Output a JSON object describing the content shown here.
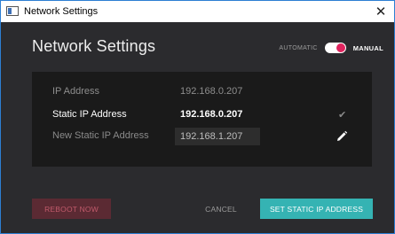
{
  "window": {
    "title": "Network Settings",
    "close_glyph": "✕"
  },
  "header": {
    "title": "Network Settings",
    "mode_automatic_label": "AUTOMATIC",
    "mode_manual_label": "MANUAL",
    "mode_selected": "MANUAL"
  },
  "panel": {
    "rows": [
      {
        "label": "IP Address",
        "value": "192.168.0.207"
      },
      {
        "label": "Static IP Address",
        "value": "192.168.0.207",
        "status_icon": "check-icon"
      },
      {
        "label": "New Static IP Address",
        "input_value": "192.168.1.207",
        "action_icon": "pencil-icon"
      }
    ]
  },
  "footer": {
    "reboot_label": "REBOOT NOW",
    "cancel_label": "CANCEL",
    "set_label": "SET STATIC IP ADDRESS"
  },
  "colors": {
    "accent_teal": "#35b3b3",
    "toggle_pink": "#e0245e",
    "reboot_bg": "#5b2a33",
    "reboot_text": "#c05a6b",
    "background": "#2b2b2e",
    "panel": "#1a1a1a"
  }
}
